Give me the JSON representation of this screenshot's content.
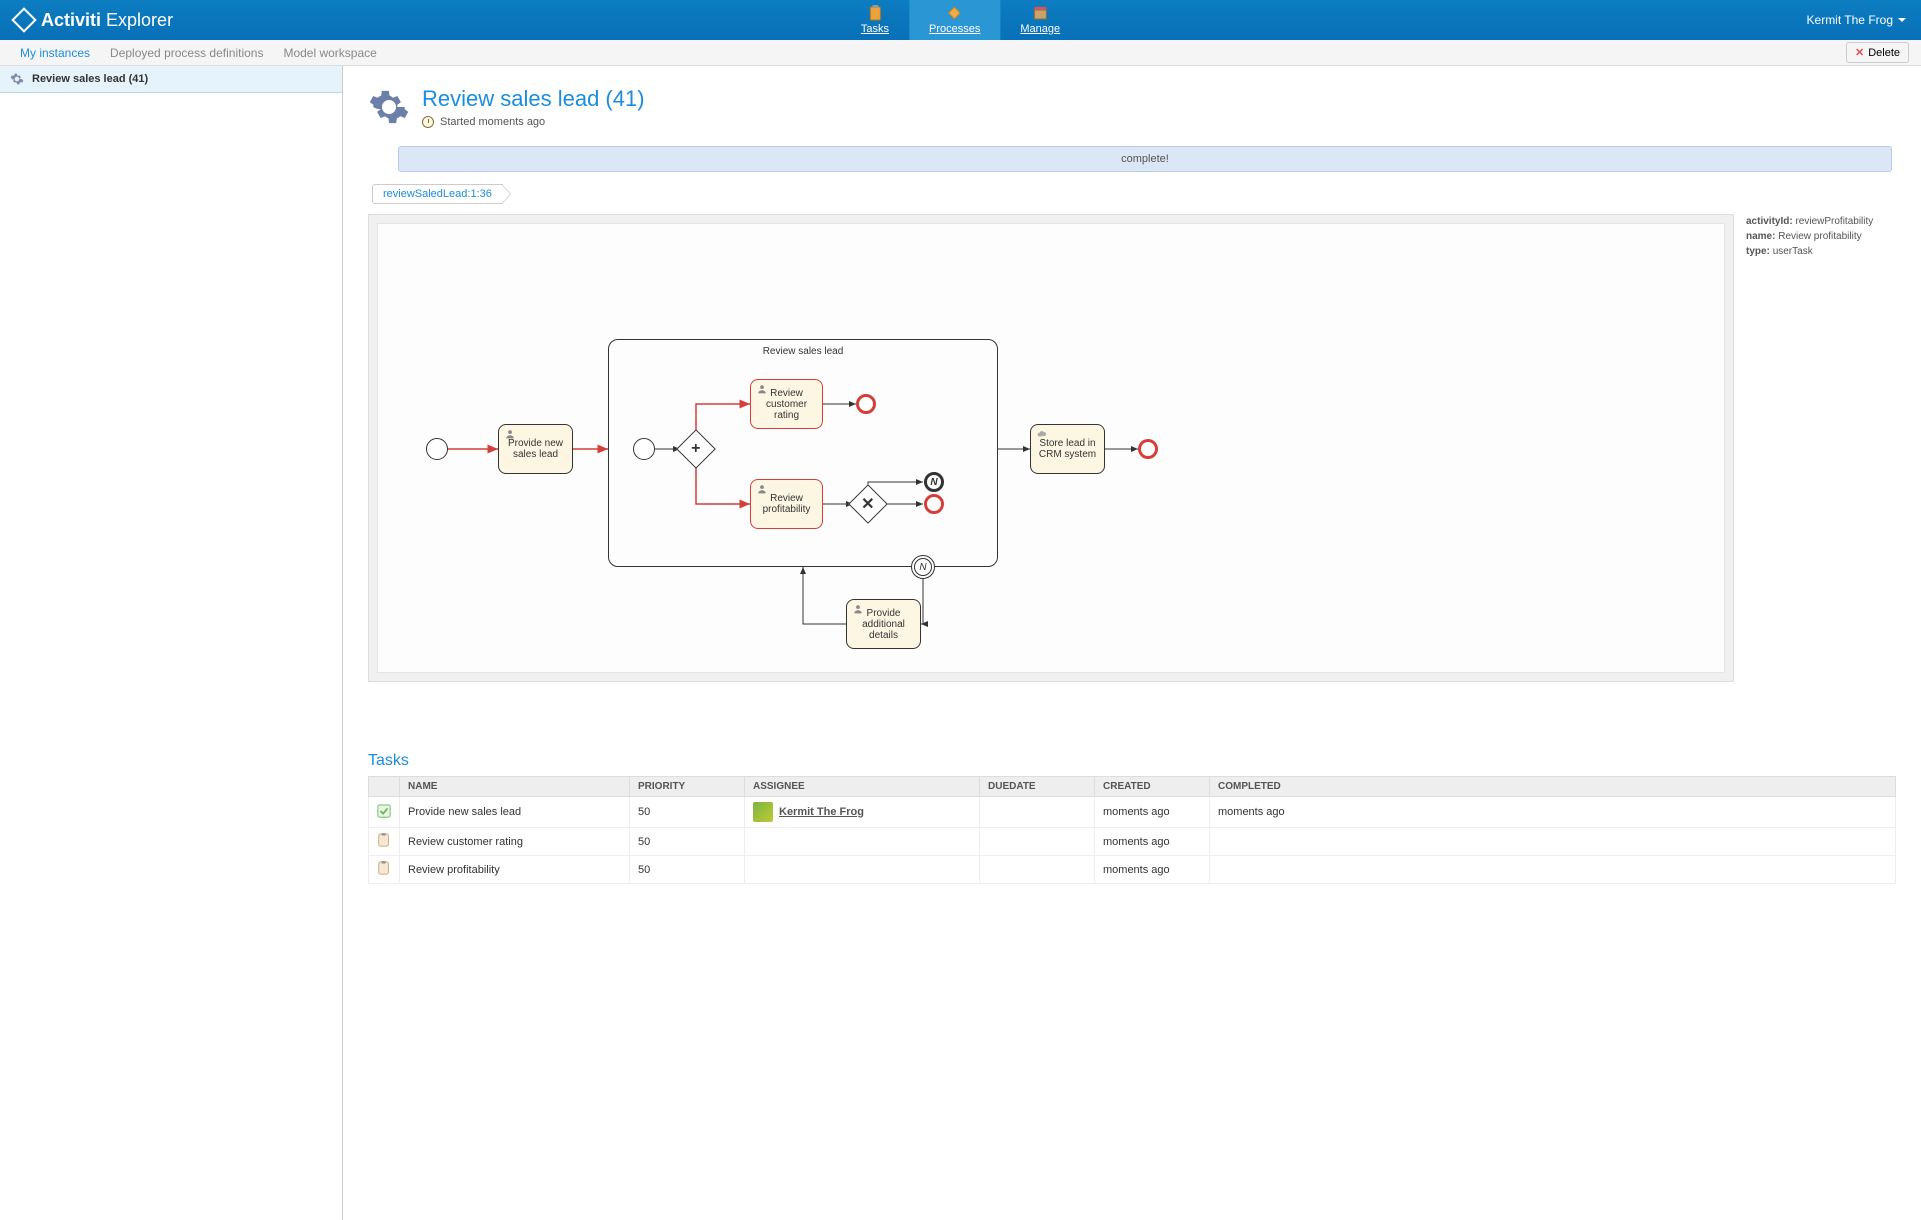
{
  "header": {
    "logo_prefix": "Activiti",
    "logo_suffix": "Explorer",
    "nav": [
      {
        "label": "Tasks",
        "icon": "clipboard"
      },
      {
        "label": "Processes",
        "icon": "diamond",
        "active": true
      },
      {
        "label": "Manage",
        "icon": "box"
      }
    ],
    "user": "Kermit The Frog"
  },
  "subnav": {
    "items": [
      {
        "label": "My instances",
        "active": true
      },
      {
        "label": "Deployed process definitions"
      },
      {
        "label": "Model workspace"
      }
    ],
    "delete_label": "Delete"
  },
  "sidebar": {
    "items": [
      {
        "label": "Review sales lead (41)"
      }
    ]
  },
  "title": {
    "heading": "Review sales lead (41)",
    "started": "Started moments ago"
  },
  "banner": "complete!",
  "breadcrumb": "reviewSaledLead:1:36",
  "diagram": {
    "subprocess_label": "Review sales lead",
    "tasks": {
      "provide_new": "Provide new sales lead",
      "review_customer": "Review customer rating",
      "review_profit": "Review profitability",
      "store_crm": "Store lead in CRM system",
      "provide_additional": "Provide additional details"
    },
    "meta": {
      "activityId_label": "activityId:",
      "activityId_value": "reviewProfitability",
      "name_label": "name:",
      "name_value": "Review profitability",
      "type_label": "type:",
      "type_value": "userTask"
    }
  },
  "tasks_section": {
    "title": "Tasks",
    "columns": [
      "NAME",
      "PRIORITY",
      "ASSIGNEE",
      "DUEDATE",
      "CREATED",
      "COMPLETED"
    ],
    "rows": [
      {
        "status": "done",
        "name": "Provide new sales lead",
        "priority": "50",
        "assignee": "Kermit The Frog",
        "duedate": "",
        "created": "moments ago",
        "completed": "moments ago"
      },
      {
        "status": "open",
        "name": "Review customer rating",
        "priority": "50",
        "assignee": "",
        "duedate": "",
        "created": "moments ago",
        "completed": ""
      },
      {
        "status": "open",
        "name": "Review profitability",
        "priority": "50",
        "assignee": "",
        "duedate": "",
        "created": "moments ago",
        "completed": ""
      }
    ]
  }
}
